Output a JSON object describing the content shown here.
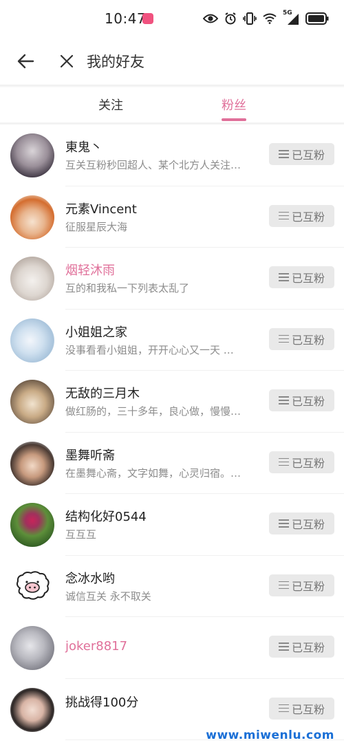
{
  "status_bar": {
    "time": "10:47",
    "icons": [
      "eye-icon",
      "alarm-icon",
      "vibrate-icon",
      "wifi-icon",
      "signal-5g-icon",
      "battery-icon"
    ],
    "network_label": "5G"
  },
  "header": {
    "title": "我的好友",
    "back_icon": "arrow-left-icon",
    "close_icon": "close-icon"
  },
  "tabs": [
    {
      "label": "关注",
      "active": false
    },
    {
      "label": "粉丝",
      "active": true
    }
  ],
  "colors": {
    "accent": "#e0709a",
    "button_bg": "#e9e9e9"
  },
  "friends": [
    {
      "name": "東鬼丶",
      "bio": "互关互粉秒回超人、某个北方人关注…",
      "button": "已互粉",
      "highlight": false
    },
    {
      "name": "元素Vincent",
      "bio": "征服星辰大海",
      "button": "已互粉",
      "highlight": false
    },
    {
      "name": "烟轻沐雨",
      "bio": "互的和我私一下列表太乱了",
      "button": "已互粉",
      "highlight": true
    },
    {
      "name": "小姐姐之家",
      "bio": "没事看看小姐姐，开开心心又一天 …",
      "button": "已互粉",
      "highlight": false
    },
    {
      "name": "无敌的三月木",
      "bio": "做红肠的，三十多年，良心做，慢慢…",
      "button": "已互粉",
      "highlight": false
    },
    {
      "name": "墨舞听斋",
      "bio": "在墨舞心斋，文字如舞，心灵归宿。…",
      "button": "已互粉",
      "highlight": false
    },
    {
      "name": "结构化好0544",
      "bio": "互互互",
      "button": "已互粉",
      "highlight": false
    },
    {
      "name": "念冰水哟",
      "bio": "诚信互关 永不取关",
      "button": "已互粉",
      "highlight": false
    },
    {
      "name": "joker8817",
      "bio": "",
      "button": "已互粉",
      "highlight": true
    },
    {
      "name": "挑战得100分",
      "bio": "",
      "button": "已互粉",
      "highlight": false
    }
  ],
  "watermark": "www.miwenlu.com"
}
